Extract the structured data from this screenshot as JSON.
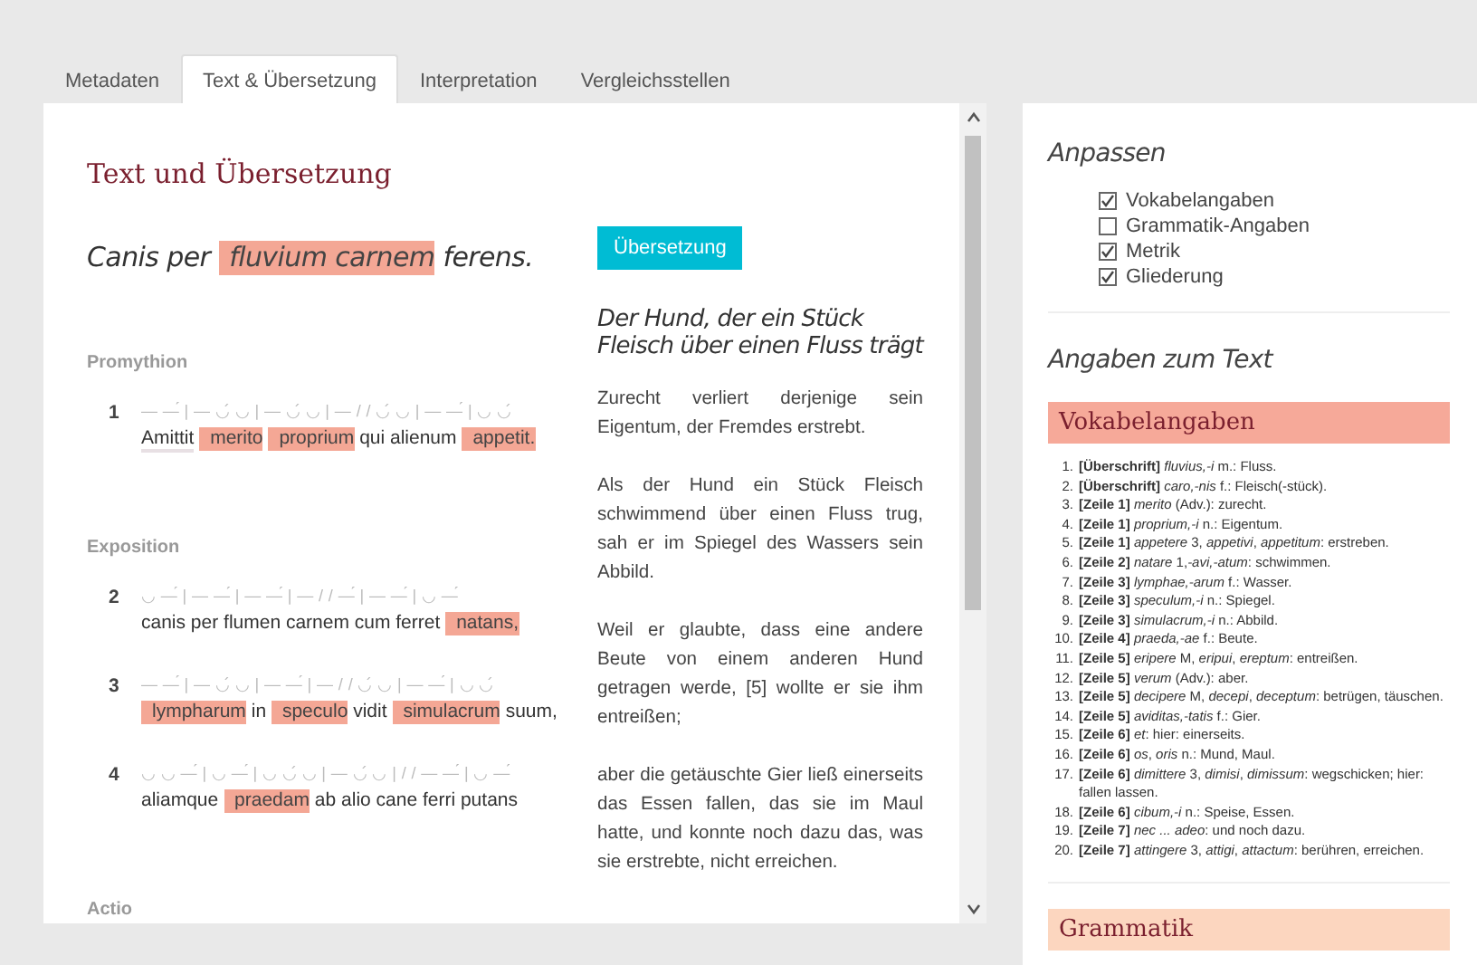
{
  "tabs": [
    {
      "label": "Metadaten",
      "selected": false
    },
    {
      "label": "Text & Übersetzung",
      "selected": true
    },
    {
      "label": "Interpretation",
      "selected": false
    },
    {
      "label": "Vergleichsstellen",
      "selected": false
    }
  ],
  "text_panel": {
    "heading": "Text und Übersetzung",
    "latin_title": [
      {
        "text": "Canis per",
        "kind": "plain"
      },
      {
        "text": "fluvium carnem",
        "kind": "vocab"
      },
      {
        "text": "ferens.",
        "kind": "plain"
      }
    ],
    "sections": [
      {
        "title": "Promythion",
        "lines": [
          {
            "number": "1",
            "meter": "— —́ | — ◡́ ◡ | — ◡́ ◡ | — / / ◡́ ◡ | — —́ | ◡ ◡́",
            "words": [
              {
                "text": "Amittit",
                "kind": "grammar"
              },
              {
                "text": "merito",
                "kind": "vocab"
              },
              {
                "text": "proprium",
                "kind": "vocab"
              },
              {
                "text": "qui alienum",
                "kind": "plain"
              },
              {
                "text": "appetit.",
                "kind": "vocab"
              }
            ]
          }
        ]
      },
      {
        "title": "Exposition",
        "lines": [
          {
            "number": "2",
            "meter": "◡ —́ | — —́ | — —́ | — / / —́ | — —́ | ◡ —́",
            "words": [
              {
                "text": "canis per flumen carnem cum ferret",
                "kind": "plain"
              },
              {
                "text": "natans,",
                "kind": "vocab"
              }
            ]
          },
          {
            "number": "3",
            "meter": "— —́ | — ◡́ ◡ | — —́ | — / / ◡́ ◡ | — —́ | ◡ ◡́",
            "words": [
              {
                "text": "lympharum",
                "kind": "vocab"
              },
              {
                "text": "in",
                "kind": "plain"
              },
              {
                "text": "speculo",
                "kind": "vocab"
              },
              {
                "text": "vidit",
                "kind": "plain"
              },
              {
                "text": "simulacrum",
                "kind": "vocab"
              },
              {
                "text": "suum,",
                "kind": "plain"
              }
            ]
          },
          {
            "number": "4",
            "meter": "◡ ◡ —́ | ◡ —́ | ◡ ◡́ ◡ | — ◡́ ◡ | / / — —́ | ◡ —́",
            "words": [
              {
                "text": "aliamque",
                "kind": "plain"
              },
              {
                "text": "praedam",
                "kind": "vocab"
              },
              {
                "text": "ab alio cane ferri putans",
                "kind": "plain"
              }
            ]
          }
        ]
      },
      {
        "title": "Actio"
      }
    ],
    "translation": {
      "button": "Übersetzung",
      "title": "Der Hund, der ein Stück Fleisch über einen Fluss trägt",
      "paragraphs": [
        "Zurecht verliert derjenige sein Eigentum, der Fremdes erstrebt.",
        "Als der Hund ein Stück Fleisch schwimmend über einen Fluss trug, sah er im Spiegel des Wassers sein Abbild.",
        "Weil er glaubte, dass eine andere Beute von einem anderen Hund getragen werde, [5] wollte er sie ihm entreißen;",
        "aber die getäuschte Gier ließ einerseits das Essen fallen, das sie im Maul hatte, und konnte noch dazu das, was sie erstrebte, nicht erreichen."
      ]
    }
  },
  "sidebar": {
    "customize": {
      "title": "Anpassen",
      "options": [
        {
          "label": "Vokabelangaben",
          "checked": true
        },
        {
          "label": "Grammatik-Angaben",
          "checked": false
        },
        {
          "label": "Metrik",
          "checked": true
        },
        {
          "label": "Gliederung",
          "checked": true
        }
      ]
    },
    "info_title": "Angaben zum Text",
    "vocabulary": {
      "title": "Vokabelangaben",
      "items": [
        {
          "number": "1.",
          "text": "**[Überschrift]** *fluvius,-i* m.: Fluss."
        },
        {
          "number": "2.",
          "text": "**[Überschrift]** *caro,-nis* f.: Fleisch(-stück)."
        },
        {
          "number": "3.",
          "text": "**[Zeile 1]** *merito* (Adv.): zurecht."
        },
        {
          "number": "4.",
          "text": "**[Zeile 1]** *proprium,-i* n.: Eigentum."
        },
        {
          "number": "5.",
          "text": "**[Zeile 1]** *appetere* 3, *appetivi*, *appetitum*: erstreben."
        },
        {
          "number": "6.",
          "text": "**[Zeile 2]** *natare* 1,*-avi,-atum*: schwimmen."
        },
        {
          "number": "7.",
          "text": "**[Zeile 3]** *lymphae,-arum* f.: Wasser."
        },
        {
          "number": "8.",
          "text": "**[Zeile 3]** *speculum,-i* n.: Spiegel."
        },
        {
          "number": "9.",
          "text": "**[Zeile 3]** *simulacrum,-i* n.: Abbild."
        },
        {
          "number": "10.",
          "text": "**[Zeile 4]** *praeda,-ae* f.: Beute."
        },
        {
          "number": "11.",
          "text": "**[Zeile 5]** *eripere* M, *eripui*, *ereptum*: entreißen."
        },
        {
          "number": "12.",
          "text": "**[Zeile 5]** *verum* (Adv.): aber."
        },
        {
          "number": "13.",
          "text": "**[Zeile 5]** *decipere* M, *decepi*, *deceptum*: betrügen, täuschen."
        },
        {
          "number": "14.",
          "text": "**[Zeile 5]** *aviditas,-tatis* f.: Gier."
        },
        {
          "number": "15.",
          "text": "**[Zeile 6]** *et*: hier: einerseits."
        },
        {
          "number": "16.",
          "text": "**[Zeile 6]** *os*, *oris* n.: Mund, Maul."
        },
        {
          "number": "17.",
          "text": "**[Zeile 6]** *dimittere* 3, *dimisi*, *dimissum*: wegschicken; hier: fallen lassen."
        },
        {
          "number": "18.",
          "text": "**[Zeile 6]** *cibum,-i* n.: Speise, Essen."
        },
        {
          "number": "19.",
          "text": "**[Zeile 7]** *nec ... adeo*: und noch dazu."
        },
        {
          "number": "20.",
          "text": "**[Zeile 7]** *attingere* 3, *attigi*, *attactum*: berühren, erreichen."
        }
      ]
    },
    "grammar": {
      "title": "Grammatik"
    }
  }
}
